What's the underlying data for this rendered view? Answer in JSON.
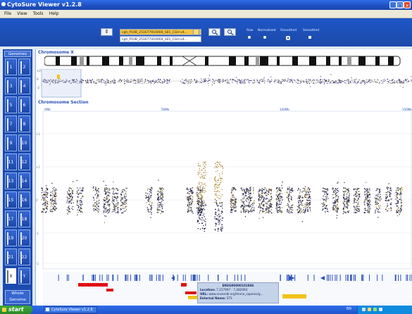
{
  "window": {
    "title": "CytoSure Viewer v1.2.8"
  },
  "menu": [
    "File",
    "View",
    "Tools",
    "Help"
  ],
  "toolbar": {
    "swap_label": "⇕",
    "arrays": [
      {
        "label": "cgh_P10B_251677910000_S01_CGH-v4...",
        "selected": true
      },
      {
        "label": "cgh_P10B_251677410004_S01_CGH-v4...",
        "selected": false
      }
    ],
    "modes": [
      "Raw",
      "Normalized",
      "Smoothed",
      "Smoothed"
    ],
    "mode_states": [
      false,
      false,
      true,
      true
    ]
  },
  "sidebar": {
    "header": "Genomes",
    "chromosomes": [
      "1",
      "2",
      "3",
      "4",
      "5",
      "6",
      "7",
      "8",
      "9",
      "10",
      "11",
      "12",
      "13",
      "14",
      "15",
      "16",
      "17",
      "18",
      "19",
      "20",
      "21",
      "22",
      "X",
      "Y"
    ],
    "active": "X",
    "whole_genome": "Whole Genome"
  },
  "overview": {
    "title": "Chromosome X",
    "yticks": [
      "+2",
      "0",
      "-2"
    ]
  },
  "section": {
    "title": "Chromosome Section",
    "xticks": [
      "0Mb",
      "50Mb",
      "100Mb",
      "150Mb"
    ],
    "yticks": [
      "+2",
      "+1",
      "0",
      "-1",
      "-2"
    ]
  },
  "popup": {
    "id": "ENSG00000101846",
    "location": "7,157997 - 7,282093",
    "url": "www.ensembl.org/Homo_sapiens/g...",
    "external_name": "STS",
    "labels": {
      "location": "Location:",
      "url": "URL:",
      "external": "External Name:"
    }
  },
  "taskbar": {
    "start": "start",
    "task": "CytoSure Viewer v1.2.8",
    "lang": "EN"
  },
  "colors": {
    "accent": "#1c4bb0",
    "selected": "#f5c542",
    "gain": "#b8962e",
    "loss": "#1c1c50",
    "gene_red": "#e01010",
    "gene_yellow": "#f2c21a",
    "gene_blue": "#2a52b8"
  }
}
